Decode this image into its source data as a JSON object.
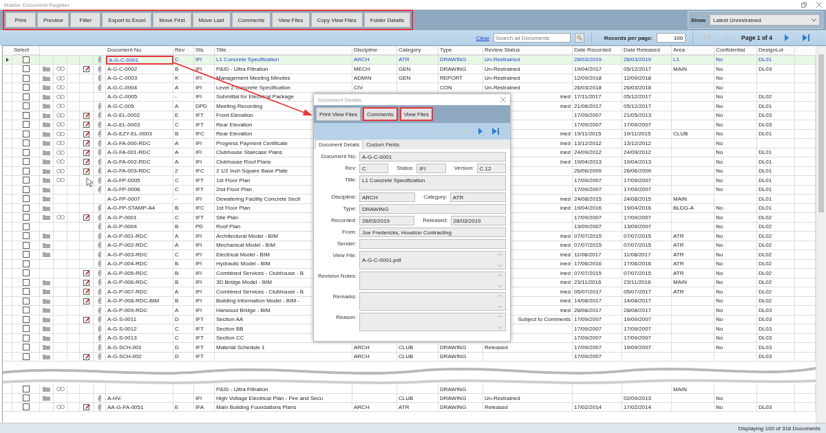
{
  "window": {
    "title": "Master Document Register"
  },
  "toolbar": {
    "highlighted": true,
    "buttons": [
      "Print",
      "Preview",
      "Filter",
      "Export to Excel",
      "Move First",
      "Move Last",
      "Comments",
      "View Files",
      "Copy View Files",
      "Folder Details"
    ]
  },
  "show": {
    "label": "Show",
    "value": "Latest Unrestrained"
  },
  "search": {
    "clear": "Clear",
    "placeholder": "Search all Documents",
    "records_label": "Records per page:",
    "records_value": "100",
    "page": "Page 1 of 4",
    "nav": [
      {
        "kind": "first",
        "disabled": true
      },
      {
        "kind": "prev",
        "disabled": true
      },
      {
        "kind": "next",
        "disabled": false
      },
      {
        "kind": "last",
        "disabled": false
      }
    ]
  },
  "table": {
    "columns": [
      "Select",
      "Document No.",
      "Rev",
      "Sts",
      "Title",
      "Discipline",
      "Category",
      "Type",
      "Review Status",
      "Date Recorded",
      "Date Released",
      "Area",
      "Confidential",
      "DesignLot"
    ],
    "rows": [
      {
        "selected": true,
        "checked": false,
        "folder": false,
        "link": false,
        "note": false,
        "clip": true,
        "doc_highlighted": true,
        "doc": "A-G-C-0001",
        "rev": "C",
        "sts": "IFI",
        "title": "L1 Concrete Specification",
        "discipline": "ARCH",
        "category": "ATR",
        "type": "DRAWING",
        "review": "Un-Restrained",
        "recorded": "28/03/2019",
        "released": "28/03/2019",
        "area": "L1",
        "confidential": "No",
        "design_lot": "DL01"
      },
      {
        "selected": false,
        "checked": false,
        "folder": true,
        "link": true,
        "note": true,
        "clip": true,
        "doc_highlighted": false,
        "doc": "A-G-C-0002",
        "rev": "B",
        "sts": "IFI",
        "title": "P&ID - Ultra Filtration",
        "discipline": "MECH",
        "category": "GEN",
        "type": "DRAWING",
        "review": "Un-Restrained",
        "recorded": "19/04/2017",
        "released": "05/12/2017",
        "area": "MAIN",
        "confidential": "No",
        "design_lot": "DL03"
      },
      {
        "selected": false,
        "checked": false,
        "folder": true,
        "link": true,
        "note": false,
        "clip": true,
        "doc_highlighted": false,
        "doc": "A-G-C-0003",
        "rev": "K",
        "sts": "IFI",
        "title": "Management Meeting Minutes",
        "discipline": "ADMIN",
        "category": "GEN",
        "type": "REPORT",
        "review": "Un-Restrained",
        "recorded": "12/09/2018",
        "released": "12/09/2018",
        "confidential": "No"
      },
      {
        "selected": false,
        "checked": false,
        "folder": true,
        "link": true,
        "note": false,
        "clip": true,
        "doc_highlighted": false,
        "doc": "A-G-C-0004",
        "rev": "A",
        "sts": "IFI",
        "title": "Level 2 Concrete Specification",
        "discipline": "CIV",
        "type": "CON",
        "review": "Un-Restrained",
        "recorded": "26/03/2018",
        "released": "26/03/2018",
        "confidential": "No"
      },
      {
        "selected": false,
        "checked": false,
        "folder": true,
        "link": true,
        "note": false,
        "clip": false,
        "doc_highlighted": false,
        "doc": "A-G-C-0005",
        "rev": "-",
        "sts": "IFI",
        "title": "Submittal for Electrical Package",
        "review": "ined",
        "recorded": "17/11/2017",
        "released": "05/12/2017",
        "confidential": "No",
        "design_lot": "DL02"
      },
      {
        "selected": false,
        "checked": false,
        "folder": true,
        "link": true,
        "note": false,
        "clip": true,
        "doc_highlighted": false,
        "doc": "A-G-C-005",
        "rev": "A",
        "sts": "DPD",
        "title": "Meeting Recording",
        "review": "ined",
        "recorded": "21/06/2017",
        "released": "05/12/2017",
        "confidential": "No",
        "design_lot": "DL01"
      },
      {
        "selected": false,
        "checked": false,
        "folder": true,
        "link": true,
        "note": true,
        "clip": true,
        "doc_highlighted": false,
        "doc": "A-G-EL-0002",
        "rev": "E",
        "sts": "IFT",
        "title": "Front Elevation",
        "recorded": "17/09/2007",
        "released": "21/05/2013",
        "confidential": "No",
        "design_lot": "DL03"
      },
      {
        "selected": false,
        "checked": false,
        "folder": true,
        "link": true,
        "note": true,
        "clip": true,
        "doc_highlighted": false,
        "doc": "A-G-EL-0003",
        "rev": "C",
        "sts": "IFT",
        "title": "Rear Elevation",
        "recorded": "17/09/2007",
        "released": "17/09/2007",
        "confidential": "No",
        "design_lot": "DL03"
      },
      {
        "selected": false,
        "checked": false,
        "folder": true,
        "link": true,
        "note": true,
        "clip": true,
        "doc_highlighted": false,
        "doc": "A-G-EZY-EL-0003",
        "rev": "B",
        "sts": "IFC",
        "title": "Rear Elevation",
        "review": "ined",
        "recorded": "19/11/2015",
        "released": "19/11/2015",
        "area": "CLUB",
        "confidential": "No",
        "design_lot": "DL01"
      },
      {
        "selected": false,
        "checked": false,
        "folder": true,
        "link": true,
        "note": true,
        "clip": true,
        "doc_highlighted": false,
        "doc": "A-G-FA-000-RDC",
        "rev": "A",
        "sts": "IFI",
        "title": "Progress Payment Certificate",
        "review": "ined",
        "recorded": "13/12/2012",
        "released": "13/12/2012",
        "confidential": "No"
      },
      {
        "selected": false,
        "checked": false,
        "folder": true,
        "link": true,
        "note": true,
        "clip": true,
        "doc_highlighted": false,
        "doc": "A-G-FA-001-RDC",
        "rev": "A",
        "sts": "IFI",
        "title": "Clubhouse Staircase Plans",
        "review": "ined",
        "recorded": "24/09/2012",
        "released": "24/09/2012",
        "confidential": "No",
        "design_lot": "DL01"
      },
      {
        "selected": false,
        "checked": false,
        "folder": true,
        "link": true,
        "note": true,
        "clip": true,
        "doc_highlighted": false,
        "doc": "A-G-FA-002-RDC",
        "rev": "A",
        "sts": "IFI",
        "title": "Clubhouse Roof Plans",
        "review": "ined",
        "recorded": "19/04/2013",
        "released": "19/04/2013",
        "confidential": "No",
        "design_lot": "DL01"
      },
      {
        "selected": false,
        "checked": false,
        "folder": true,
        "link": true,
        "note": true,
        "clip": true,
        "doc_highlighted": false,
        "doc": "A-G-FA-003-RDC",
        "rev": "2",
        "sts": "IFC",
        "title": "2 1/2 Inch Square Base Plate",
        "recorded": "26/06/2009",
        "released": "26/06/2009",
        "confidential": "No",
        "design_lot": "DL01"
      },
      {
        "selected": false,
        "checked": false,
        "folder": true,
        "link": true,
        "note": false,
        "clip": true,
        "doc_highlighted": false,
        "doc": "A-G-FP-0005",
        "rev": "C",
        "sts": "IFT",
        "title": "1st Floor Plan",
        "recorded": "17/09/2007",
        "released": "17/09/2007",
        "confidential": "No",
        "design_lot": "DL01"
      },
      {
        "selected": false,
        "checked": false,
        "folder": true,
        "link": false,
        "note": false,
        "clip": true,
        "doc_highlighted": false,
        "doc": "A-G-FP-0006",
        "rev": "C",
        "sts": "IFT",
        "title": "2nd Floor Plan",
        "recorded": "17/09/2007",
        "released": "17/09/2007",
        "confidential": "No",
        "design_lot": "DL01"
      },
      {
        "selected": false,
        "checked": false,
        "folder": true,
        "link": false,
        "note": false,
        "clip": false,
        "doc_highlighted": false,
        "doc": "A-G-FP-0007",
        "rev": "-",
        "sts": "IFI",
        "title": "Dewatering Facility Concrete Secti",
        "review": "ined",
        "recorded": "24/08/2015",
        "released": "24/08/2015",
        "area": "MAIN",
        "design_lot": "DL01"
      },
      {
        "selected": false,
        "checked": false,
        "folder": true,
        "link": false,
        "note": false,
        "clip": true,
        "doc_highlighted": false,
        "doc": "A-G-FP-STAMP-A4",
        "rev": "B",
        "sts": "IFC",
        "title": "1st Floor Plan",
        "review": "ined",
        "recorded": "19/04/2016",
        "released": "19/04/2016",
        "area": "BLDG-A",
        "confidential": "No",
        "design_lot": "DL01"
      },
      {
        "selected": false,
        "checked": false,
        "folder": true,
        "link": true,
        "note": true,
        "clip": true,
        "doc_highlighted": false,
        "doc": "A-G-P-0001",
        "rev": "C",
        "sts": "IFT",
        "title": "Site Plan",
        "recorded": "17/09/2007",
        "released": "17/09/2007",
        "confidential": "No",
        "design_lot": "DL02"
      },
      {
        "selected": false,
        "checked": false,
        "folder": false,
        "link": false,
        "note": false,
        "clip": true,
        "doc_highlighted": false,
        "doc": "A-G-P-0004",
        "rev": "B",
        "sts": "PD",
        "title": "Roof Plan",
        "recorded": "13/09/2007",
        "released": "13/09/2007",
        "confidential": "No",
        "design_lot": "DL02"
      },
      {
        "selected": false,
        "checked": false,
        "folder": true,
        "link": false,
        "note": false,
        "clip": true,
        "doc_highlighted": false,
        "doc": "A-G-P-001-RDC",
        "rev": "A",
        "sts": "IFI",
        "title": "Architectural Model - BIM",
        "review": "ined",
        "recorded": "07/07/2015",
        "released": "07/07/2015",
        "area": "ATR",
        "confidential": "No",
        "design_lot": "DL02"
      },
      {
        "selected": false,
        "checked": false,
        "folder": true,
        "link": false,
        "note": false,
        "clip": true,
        "doc_highlighted": false,
        "doc": "A-G-P-002-RDC",
        "rev": "A",
        "sts": "IFI",
        "title": "Mechanical Model - BIM",
        "review": "ined",
        "recorded": "07/07/2015",
        "released": "07/07/2015",
        "area": "ATR",
        "confidential": "No",
        "design_lot": "DL02"
      },
      {
        "selected": false,
        "checked": false,
        "folder": true,
        "link": false,
        "note": false,
        "clip": true,
        "doc_highlighted": false,
        "doc": "A-G-P-003-RDC",
        "rev": "C",
        "sts": "IFI",
        "title": "Electrical Model - BIM",
        "review": "ined",
        "recorded": "11/08/2017",
        "released": "11/08/2017",
        "area": "ATR",
        "confidential": "No",
        "design_lot": "DL02"
      },
      {
        "selected": false,
        "checked": false,
        "folder": false,
        "link": false,
        "note": false,
        "clip": true,
        "doc_highlighted": false,
        "doc": "A-G-P-004-RDC",
        "rev": "B",
        "sts": "IFI",
        "title": "Hydraulic Model - BIM",
        "review": "ined",
        "recorded": "17/06/2016",
        "released": "17/06/2016",
        "area": "ATR",
        "confidential": "No",
        "design_lot": "DL02"
      },
      {
        "selected": false,
        "checked": false,
        "folder": false,
        "link": false,
        "note": true,
        "clip": true,
        "doc_highlighted": false,
        "doc": "A-G-P-005-RDC",
        "rev": "B",
        "sts": "IFI",
        "title": "Combined Services - Clubhouse - B",
        "review": "ined",
        "recorded": "07/07/2015",
        "released": "07/07/2015",
        "area": "ATR",
        "confidential": "No",
        "design_lot": "DL02"
      },
      {
        "selected": false,
        "checked": false,
        "folder": true,
        "link": false,
        "note": true,
        "clip": true,
        "doc_highlighted": false,
        "doc": "A-G-P-006-RDC",
        "rev": "B",
        "sts": "IFI",
        "title": "3D Bridge Model - BIM",
        "review": "ined",
        "recorded": "23/11/2016",
        "released": "23/11/2016",
        "area": "MAIN",
        "confidential": "No",
        "design_lot": "DL02"
      },
      {
        "selected": false,
        "checked": false,
        "folder": true,
        "link": false,
        "note": true,
        "clip": true,
        "doc_highlighted": false,
        "doc": "A-G-P-007-RDC",
        "rev": "A",
        "sts": "IFI",
        "title": "Combined Services - Clubhouse - B",
        "review": "ined",
        "recorded": "05/07/2017",
        "released": "05/07/2017",
        "area": "ATR",
        "confidential": "No",
        "design_lot": "DL02"
      },
      {
        "selected": false,
        "checked": false,
        "folder": true,
        "link": false,
        "note": true,
        "clip": true,
        "doc_highlighted": false,
        "doc": "A-G-P-008-RDC-BIM",
        "rev": "B",
        "sts": "IFI",
        "title": "Building Information Model - BIM -",
        "review": "ined",
        "recorded": "14/08/2017",
        "released": "14/08/2017",
        "confidential": "No",
        "design_lot": "DL02"
      },
      {
        "selected": false,
        "checked": false,
        "folder": true,
        "link": false,
        "note": false,
        "clip": true,
        "doc_highlighted": false,
        "doc": "A-G-P-009-RDC",
        "rev": "A",
        "sts": "IFI",
        "title": "Harwood Bridge - BIM",
        "review": "ined",
        "recorded": "28/08/2017",
        "released": "28/08/2017",
        "confidential": "No",
        "design_lot": "DL03"
      },
      {
        "selected": false,
        "checked": false,
        "folder": true,
        "link": false,
        "note": true,
        "clip": true,
        "doc_highlighted": false,
        "doc": "A-G-S-0011",
        "rev": "D",
        "sts": "IFT",
        "title": "Section AA",
        "review": "Subject to Comments",
        "recorded": "17/09/2007",
        "released": "19/09/2007",
        "confidential": "No",
        "design_lot": "DL03"
      },
      {
        "selected": false,
        "checked": false,
        "folder": true,
        "link": false,
        "note": false,
        "clip": true,
        "doc_highlighted": false,
        "doc": "A-G-S-0012",
        "rev": "C",
        "sts": "IFT",
        "title": "Section BB",
        "recorded": "17/09/2007",
        "released": "17/09/2007",
        "confidential": "No",
        "design_lot": "DL03"
      },
      {
        "selected": false,
        "checked": false,
        "folder": true,
        "link": false,
        "note": false,
        "clip": true,
        "doc_highlighted": false,
        "doc": "A-G-S-0013",
        "rev": "C",
        "sts": "IFT",
        "title": "Section CC",
        "recorded": "17/09/2007",
        "released": "17/09/2007",
        "confidential": "No",
        "design_lot": "DL03"
      },
      {
        "selected": false,
        "checked": false,
        "folder": true,
        "link": false,
        "note": false,
        "clip": true,
        "doc_highlighted": false,
        "doc": "A-G-SCH-001",
        "rev": "D",
        "sts": "IFT",
        "title": "Material Schedule 1",
        "discipline": "ARCH",
        "category": "CLUB",
        "type": "DRAWING",
        "review": "Released",
        "recorded": "17/09/2007",
        "released": "19/09/2007",
        "confidential": "No",
        "design_lot": "DL03"
      },
      {
        "selected": false,
        "checked": false,
        "folder": true,
        "link": false,
        "note": true,
        "clip": true,
        "doc_highlighted": false,
        "doc": "A-G-SCH-002",
        "rev": "D",
        "sts": "IFT",
        "discipline": "ARCH",
        "category": "CLUB",
        "type": "DRAWING",
        "recorded": "17/09/2007",
        "design_lot": "DL03"
      }
    ],
    "bottom_rows": [
      {
        "selected": false,
        "checked": false,
        "folder": true,
        "link": true,
        "note": false,
        "clip": false,
        "doc_highlighted": false,
        "title": "P&ID - Ultra Filtration",
        "type": "DRAWING",
        "area": "MAIN"
      },
      {
        "selected": false,
        "checked": false,
        "folder": true,
        "link": false,
        "note": false,
        "clip": true,
        "doc_highlighted": false,
        "doc": "A-HV-",
        "sts": "IFI",
        "title": "High Voltage Electrical Plan - Fire and Secu",
        "category": "CLUB",
        "type": "DRAWING",
        "review": "Un-Restrained",
        "released": "02/09/2013",
        "confidential": "No"
      },
      {
        "selected": false,
        "checked": false,
        "folder": false,
        "link": true,
        "note": true,
        "clip": true,
        "doc_highlighted": false,
        "doc": "AA-G-FA-0051",
        "rev": "E",
        "sts": "IFA",
        "title": "Main Building Foundations Plans",
        "discipline": "ARCH",
        "category": "ATR",
        "type": "DRAWING",
        "review": "Released",
        "recorded": "17/02/2014",
        "released": "17/02/2014",
        "confidential": "No",
        "design_lot": "DL03"
      }
    ]
  },
  "dialog": {
    "title": "Document Details",
    "buttons": [
      {
        "label": "Print View Files",
        "highlighted": false
      },
      {
        "label": "Comments",
        "highlighted": true
      },
      {
        "label": "View Files",
        "highlighted": true
      }
    ],
    "nav": [
      {
        "kind": "first",
        "disabled": true
      },
      {
        "kind": "prev",
        "disabled": true
      },
      {
        "kind": "next",
        "disabled": false
      },
      {
        "kind": "last",
        "disabled": false
      }
    ],
    "tabs": [
      {
        "label": "Document Details",
        "selected": true
      },
      {
        "label": "Custom Fields",
        "selected": false
      }
    ],
    "field_rows": [
      [
        {
          "kind": "line",
          "label": "Document No:",
          "value": "A-G-C-0001"
        }
      ],
      [
        {
          "kind": "line",
          "label": "Rev:",
          "value": "C"
        },
        {
          "kind": "line",
          "label": "Status:",
          "value": "IFI"
        },
        {
          "kind": "line",
          "label": "Version:",
          "value": "C.12"
        }
      ],
      [
        {
          "kind": "tall",
          "label": "Title:",
          "value": "L1 Concrete Specification"
        }
      ],
      [
        {
          "kind": "line",
          "label": "Discipline:",
          "value": "ARCH"
        },
        {
          "kind": "line",
          "label": "Category:",
          "value": "ATR"
        }
      ],
      [
        {
          "kind": "line",
          "label": "Type:",
          "value": "DRAWING"
        }
      ],
      [
        {
          "kind": "line",
          "label": "Recorded:",
          "value": "28/03/2019"
        },
        {
          "kind": "line",
          "label": "Released:",
          "value": "28/03/2019"
        }
      ],
      [
        {
          "kind": "line",
          "label": "From:",
          "value": "Joe Fredericks, Houston Contracting"
        }
      ],
      [
        {
          "kind": "line",
          "label": "Sender:"
        }
      ],
      [
        {
          "kind": "scroll",
          "label": "View File:",
          "value": "A-G-C-0001.pdf"
        }
      ],
      [
        {
          "kind": "scroll",
          "label": "Revision Notes:"
        }
      ],
      [
        {
          "kind": "scroll",
          "label": "Remarks:"
        }
      ],
      [
        {
          "kind": "scroll",
          "label": "Reason:"
        }
      ]
    ]
  },
  "status_bar": "Displaying 100 of 318 Documents"
}
